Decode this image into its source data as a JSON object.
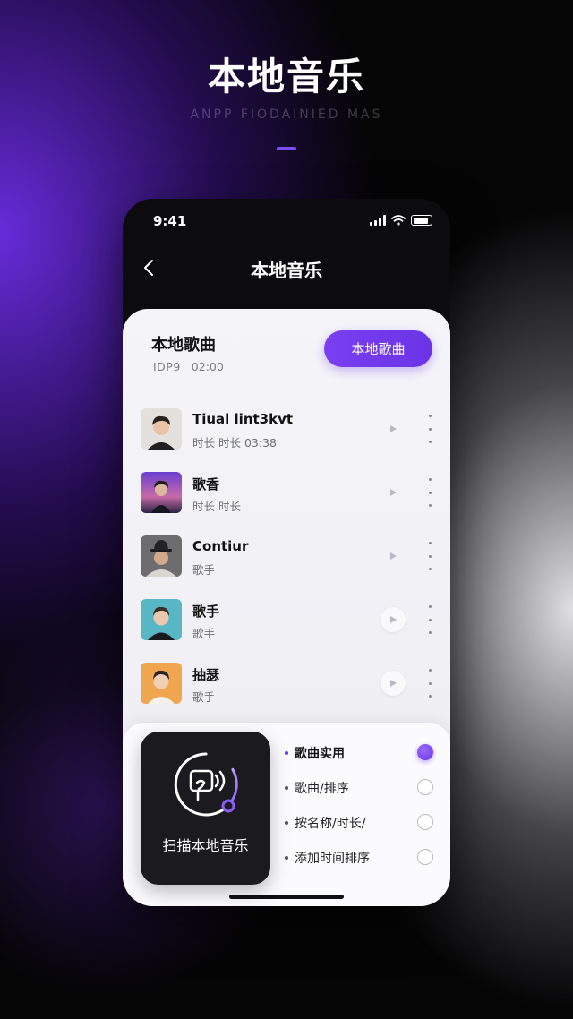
{
  "hero": {
    "title": "本地音乐",
    "subtitle": "ANPP FIODAINIED MAS"
  },
  "status_bar": {
    "time": "9:41"
  },
  "nav": {
    "title": "本地音乐"
  },
  "library": {
    "title": "本地歌曲",
    "meta_label": "IDP9",
    "meta_time": "02:00",
    "action_button": "本地歌曲"
  },
  "songs": [
    {
      "title": "Tiual lint3kvt",
      "subtitle": "时长  时长  03:38"
    },
    {
      "title": "歌香",
      "subtitle": "时长  时长"
    },
    {
      "title": "Contiur",
      "subtitle": "歌手"
    },
    {
      "title": "歌手",
      "subtitle": "歌手"
    },
    {
      "title": "抽瑟",
      "subtitle": "歌手"
    }
  ],
  "scan": {
    "label": "扫描本地音乐"
  },
  "sort_options": [
    {
      "label": "歌曲实用",
      "selected": true
    },
    {
      "label": "歌曲/排序",
      "selected": false
    },
    {
      "label": "按名称/时长/",
      "selected": false
    },
    {
      "label": "添加时间排序",
      "selected": false
    }
  ],
  "colors": {
    "accent": "#6a34e6",
    "background": "#050506",
    "card": "#f2f2f6",
    "dark_card": "#1a1a1f"
  },
  "icons": {
    "back": "chevron-left-icon",
    "play": "play-icon",
    "more": "more-vertical-icon",
    "scan": "music-scan-icon",
    "signal": "signal-icon",
    "wifi": "wifi-icon",
    "battery": "battery-icon"
  }
}
